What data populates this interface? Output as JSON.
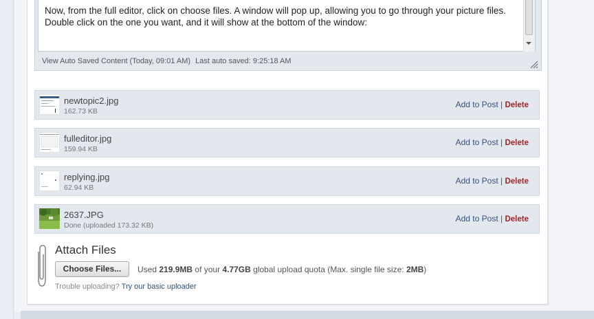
{
  "editor": {
    "text": "Now, from the full editor, click on choose files.  A window will pop up, allowing you to go through your picture files.  Double click on the one you want, and it will show at the bottom of the window:",
    "view_autosaved": "View Auto Saved Content (Today, 09:01 AM)",
    "last_saved": "Last auto saved: 9:25:18 AM"
  },
  "attachments": [
    {
      "name": "newtopic2.jpg",
      "info": "162.73 KB",
      "add_label": "Add to Post",
      "separator": "|",
      "delete_label": "Delete",
      "thumb": "screenshot-thumbnail"
    },
    {
      "name": "fulleditor.jpg",
      "info": "159.94 KB",
      "add_label": "Add to Post",
      "separator": "|",
      "delete_label": "Delete",
      "thumb": "screenshot-thumbnail"
    },
    {
      "name": "replying.jpg",
      "info": "62.94 KB",
      "add_label": "Add to Post",
      "separator": "|",
      "delete_label": "Delete",
      "thumb": "screenshot-thumbnail"
    },
    {
      "name": "2637.JPG",
      "info": "Done (uploaded 173.32 KB)",
      "add_label": "Add to Post",
      "separator": "|",
      "delete_label": "Delete",
      "thumb": "garden-photo-thumbnail"
    }
  ],
  "attach": {
    "title": "Attach Files",
    "choose_button": "Choose Files...",
    "quota_used_prefix": "Used",
    "quota_used": "219.9MB",
    "quota_of": "of your",
    "quota_total": "4.77GB",
    "quota_mid": "global upload quota (Max. single file size:",
    "quota_max": "2MB",
    "quota_end": ")",
    "trouble_text": "Trouble uploading?",
    "trouble_link": "Try our basic uploader",
    "icon": "paperclip-icon"
  },
  "colors": {
    "link_blue": "#34507a",
    "delete_red": "#a2252b",
    "row_bg": "#e3e8ef"
  }
}
